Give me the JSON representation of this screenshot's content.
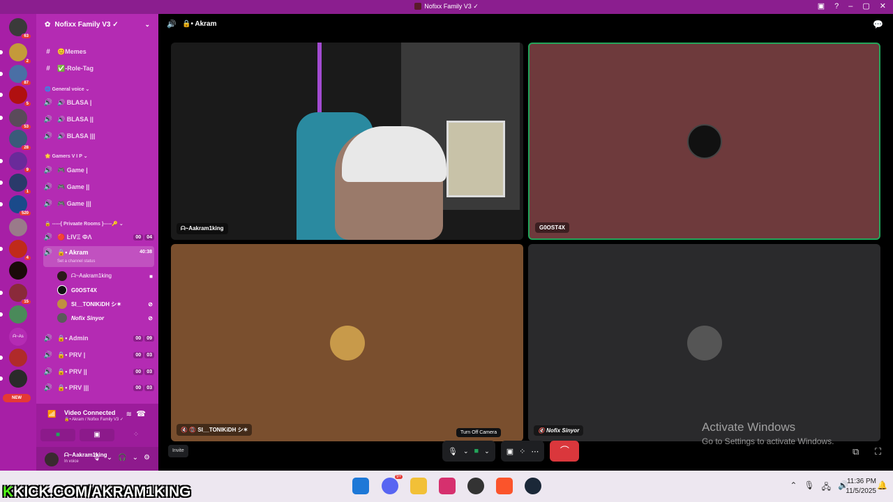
{
  "window": {
    "title": "Nofixx Family V3 ✓"
  },
  "server_rail": {
    "badges": [
      "63",
      "2",
      "87",
      "5",
      "53",
      "28",
      "9",
      "1",
      "520",
      "4",
      "15"
    ],
    "new_label": "NEW",
    "small_label": "ᗩ~As"
  },
  "guild": {
    "name": "Nofixx Family V3 ✓"
  },
  "channels": {
    "text": [
      {
        "name": "😊Memes"
      },
      {
        "name": "✅-Role-Tag"
      }
    ],
    "categories": {
      "general_voice": "General voice",
      "gamers_vip": "Gamers V I P",
      "private_rooms": "-----{ Privaate Rooms }-----🔑"
    },
    "general_voice": [
      "🔊 BLASA |",
      "🔊 BLASA ||",
      "🔊 BLASA |||"
    ],
    "gamers_vip": [
      "🎮 Game |",
      "🎮 Game ||",
      "🎮 Game |||"
    ],
    "private": [
      {
        "name": "🔴 ĿIVΞ ФΛ",
        "c1": "00",
        "c2": "04"
      },
      {
        "name": "🔒• Akram",
        "timer": "40:38",
        "status": "Set a channel status"
      },
      {
        "name": "🔒• Admin",
        "c1": "00",
        "c2": "09"
      },
      {
        "name": "🔒• PRV |",
        "c1": "00",
        "c2": "03"
      },
      {
        "name": "🔒• PRV ||",
        "c1": "00",
        "c2": "03"
      },
      {
        "name": "🔒• PRV |||",
        "c1": "00",
        "c2": "03"
      }
    ],
    "members": [
      "ᗩ~Aakram1king",
      "G0OST4X",
      "SI__TONIKiDH シ✶",
      "Nofix Sinyor"
    ]
  },
  "voice_panel": {
    "status": "Video Connected",
    "location": "🔒• Akram / Nofixx Family V3 ✓"
  },
  "user_panel": {
    "name": "ᗩ~Aakram1king",
    "status": "In voice"
  },
  "call": {
    "channel_name": "🔒• Akram",
    "tiles": [
      {
        "label": "ᗩ~Aakram1king",
        "bg": "#1a1a1a"
      },
      {
        "label": "G0OST4X",
        "bg": "#6e3a3c"
      },
      {
        "label": "🔇 📵 SI__TONIKiDH シ✶",
        "bg": "#7a4f2e"
      },
      {
        "label": "🔇 Nofix Sinyor",
        "bg": "#2a2a2c"
      }
    ],
    "invite_label": "Invite",
    "tooltip": "Turn Off Camera"
  },
  "watermark": {
    "line1": "Activate Windows",
    "line2": "Go to Settings to activate Windows."
  },
  "taskbar": {
    "time": "11:36 PM",
    "date": "11/5/2025",
    "discord_badge": "9+"
  },
  "overlay": {
    "k": "K",
    "text": "KICK.COM/AKRAM1KING"
  }
}
